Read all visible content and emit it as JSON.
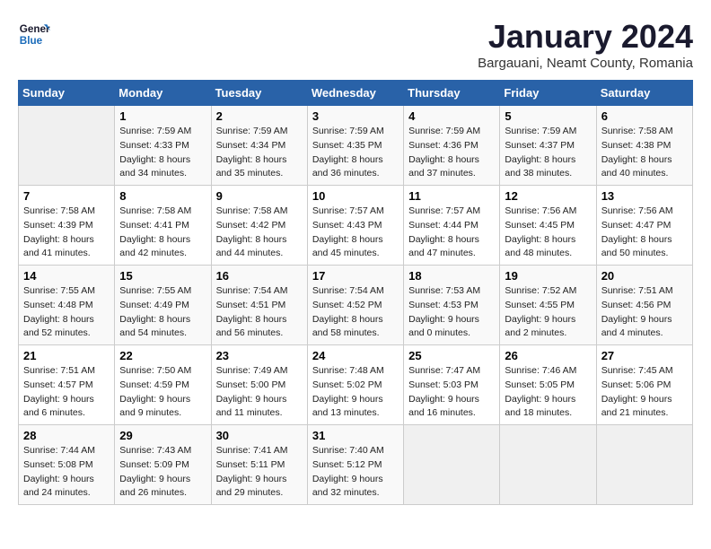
{
  "logo": {
    "line1": "General",
    "line2": "Blue"
  },
  "title": "January 2024",
  "subtitle": "Bargauani, Neamt County, Romania",
  "weekdays": [
    "Sunday",
    "Monday",
    "Tuesday",
    "Wednesday",
    "Thursday",
    "Friday",
    "Saturday"
  ],
  "weeks": [
    [
      {
        "day": "",
        "info": ""
      },
      {
        "day": "1",
        "info": "Sunrise: 7:59 AM\nSunset: 4:33 PM\nDaylight: 8 hours\nand 34 minutes."
      },
      {
        "day": "2",
        "info": "Sunrise: 7:59 AM\nSunset: 4:34 PM\nDaylight: 8 hours\nand 35 minutes."
      },
      {
        "day": "3",
        "info": "Sunrise: 7:59 AM\nSunset: 4:35 PM\nDaylight: 8 hours\nand 36 minutes."
      },
      {
        "day": "4",
        "info": "Sunrise: 7:59 AM\nSunset: 4:36 PM\nDaylight: 8 hours\nand 37 minutes."
      },
      {
        "day": "5",
        "info": "Sunrise: 7:59 AM\nSunset: 4:37 PM\nDaylight: 8 hours\nand 38 minutes."
      },
      {
        "day": "6",
        "info": "Sunrise: 7:58 AM\nSunset: 4:38 PM\nDaylight: 8 hours\nand 40 minutes."
      }
    ],
    [
      {
        "day": "7",
        "info": "Sunrise: 7:58 AM\nSunset: 4:39 PM\nDaylight: 8 hours\nand 41 minutes."
      },
      {
        "day": "8",
        "info": "Sunrise: 7:58 AM\nSunset: 4:41 PM\nDaylight: 8 hours\nand 42 minutes."
      },
      {
        "day": "9",
        "info": "Sunrise: 7:58 AM\nSunset: 4:42 PM\nDaylight: 8 hours\nand 44 minutes."
      },
      {
        "day": "10",
        "info": "Sunrise: 7:57 AM\nSunset: 4:43 PM\nDaylight: 8 hours\nand 45 minutes."
      },
      {
        "day": "11",
        "info": "Sunrise: 7:57 AM\nSunset: 4:44 PM\nDaylight: 8 hours\nand 47 minutes."
      },
      {
        "day": "12",
        "info": "Sunrise: 7:56 AM\nSunset: 4:45 PM\nDaylight: 8 hours\nand 48 minutes."
      },
      {
        "day": "13",
        "info": "Sunrise: 7:56 AM\nSunset: 4:47 PM\nDaylight: 8 hours\nand 50 minutes."
      }
    ],
    [
      {
        "day": "14",
        "info": "Sunrise: 7:55 AM\nSunset: 4:48 PM\nDaylight: 8 hours\nand 52 minutes."
      },
      {
        "day": "15",
        "info": "Sunrise: 7:55 AM\nSunset: 4:49 PM\nDaylight: 8 hours\nand 54 minutes."
      },
      {
        "day": "16",
        "info": "Sunrise: 7:54 AM\nSunset: 4:51 PM\nDaylight: 8 hours\nand 56 minutes."
      },
      {
        "day": "17",
        "info": "Sunrise: 7:54 AM\nSunset: 4:52 PM\nDaylight: 8 hours\nand 58 minutes."
      },
      {
        "day": "18",
        "info": "Sunrise: 7:53 AM\nSunset: 4:53 PM\nDaylight: 9 hours\nand 0 minutes."
      },
      {
        "day": "19",
        "info": "Sunrise: 7:52 AM\nSunset: 4:55 PM\nDaylight: 9 hours\nand 2 minutes."
      },
      {
        "day": "20",
        "info": "Sunrise: 7:51 AM\nSunset: 4:56 PM\nDaylight: 9 hours\nand 4 minutes."
      }
    ],
    [
      {
        "day": "21",
        "info": "Sunrise: 7:51 AM\nSunset: 4:57 PM\nDaylight: 9 hours\nand 6 minutes."
      },
      {
        "day": "22",
        "info": "Sunrise: 7:50 AM\nSunset: 4:59 PM\nDaylight: 9 hours\nand 9 minutes."
      },
      {
        "day": "23",
        "info": "Sunrise: 7:49 AM\nSunset: 5:00 PM\nDaylight: 9 hours\nand 11 minutes."
      },
      {
        "day": "24",
        "info": "Sunrise: 7:48 AM\nSunset: 5:02 PM\nDaylight: 9 hours\nand 13 minutes."
      },
      {
        "day": "25",
        "info": "Sunrise: 7:47 AM\nSunset: 5:03 PM\nDaylight: 9 hours\nand 16 minutes."
      },
      {
        "day": "26",
        "info": "Sunrise: 7:46 AM\nSunset: 5:05 PM\nDaylight: 9 hours\nand 18 minutes."
      },
      {
        "day": "27",
        "info": "Sunrise: 7:45 AM\nSunset: 5:06 PM\nDaylight: 9 hours\nand 21 minutes."
      }
    ],
    [
      {
        "day": "28",
        "info": "Sunrise: 7:44 AM\nSunset: 5:08 PM\nDaylight: 9 hours\nand 24 minutes."
      },
      {
        "day": "29",
        "info": "Sunrise: 7:43 AM\nSunset: 5:09 PM\nDaylight: 9 hours\nand 26 minutes."
      },
      {
        "day": "30",
        "info": "Sunrise: 7:41 AM\nSunset: 5:11 PM\nDaylight: 9 hours\nand 29 minutes."
      },
      {
        "day": "31",
        "info": "Sunrise: 7:40 AM\nSunset: 5:12 PM\nDaylight: 9 hours\nand 32 minutes."
      },
      {
        "day": "",
        "info": ""
      },
      {
        "day": "",
        "info": ""
      },
      {
        "day": "",
        "info": ""
      }
    ]
  ]
}
